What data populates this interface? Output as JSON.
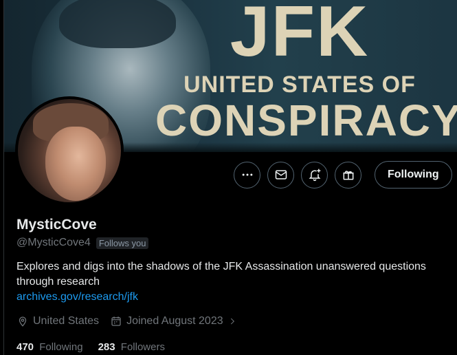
{
  "banner": {
    "title": "JFK",
    "subtitle": "UNITED STATES OF",
    "main": "CONSPIRACY"
  },
  "actions": {
    "more_icon": "more-icon",
    "message_icon": "mail-icon",
    "notify_icon": "bell-plus-icon",
    "subscribe_icon": "gift-icon",
    "following_label": "Following"
  },
  "profile": {
    "display_name": "MysticCove",
    "handle": "@MysticCove4",
    "follows_you": "Follows you",
    "bio": "Explores and digs into the shadows of the JFK Assassination unanswered questions through research",
    "link": "archives.gov/research/jfk",
    "location": "United States",
    "joined": "Joined August 2023"
  },
  "stats": {
    "following_count": "470",
    "following_label": "Following",
    "followers_count": "283",
    "followers_label": "Followers"
  },
  "colors": {
    "background": "#000000",
    "link": "#1d9bf0",
    "muted": "#71767b",
    "banner_text": "#ddd3b6"
  }
}
